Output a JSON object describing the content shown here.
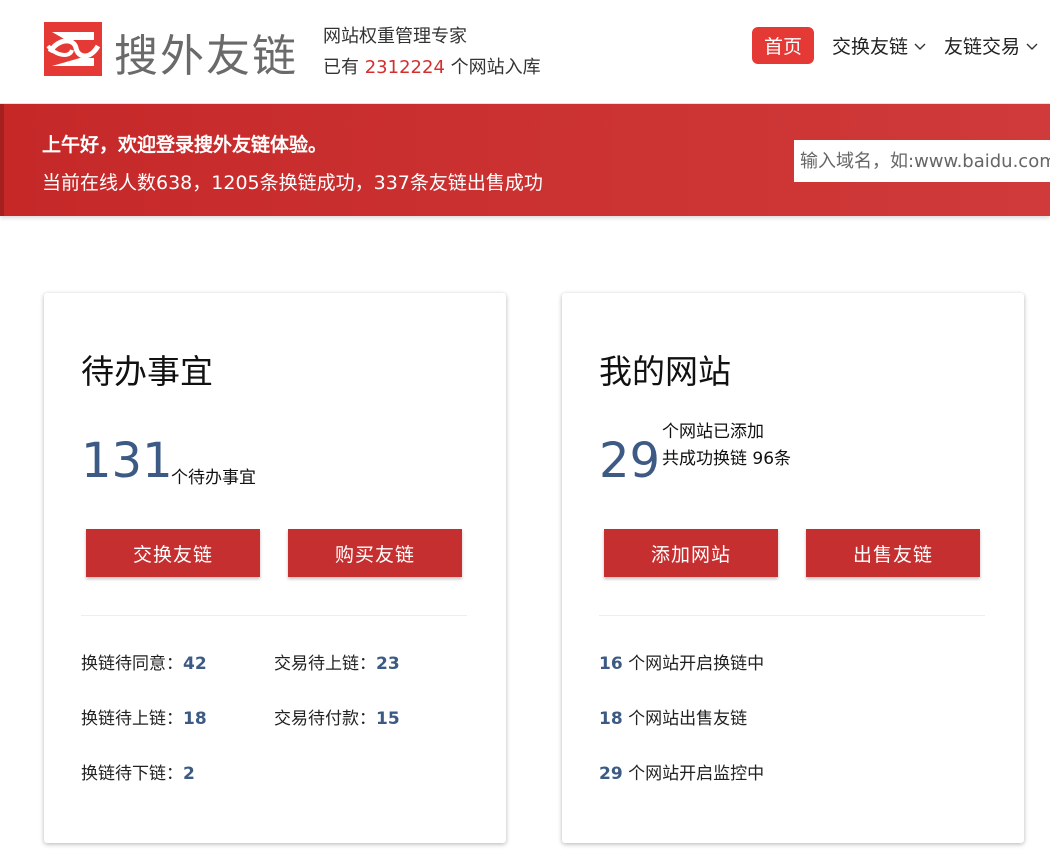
{
  "header": {
    "logo_text": "搜外友链",
    "slogan": "网站权重管理专家",
    "count_prefix": "已有",
    "count_value": "2312224",
    "count_suffix": "个网站入库",
    "nav": {
      "home": "首页",
      "exchange": "交换友链",
      "trade": "友链交易"
    },
    "brand_color": "#e53935"
  },
  "banner": {
    "welcome": "上午好，欢迎登录搜外友链体验。",
    "stats": "当前在线人数638，1205条换链成功，337条友链出售成功",
    "search_placeholder": "输入域名，如:www.baidu.com"
  },
  "todo": {
    "title": "待办事宜",
    "count": "131",
    "count_label": "个待办事宜",
    "btn_exchange": "交换友链",
    "btn_buy": "购买友链",
    "stats": [
      {
        "label": "换链待同意：",
        "value": "42"
      },
      {
        "label": "交易待上链：",
        "value": "23"
      },
      {
        "label": "换链待上链：",
        "value": "18"
      },
      {
        "label": "交易待付款：",
        "value": "15"
      },
      {
        "label": "换链待下链：",
        "value": "2"
      }
    ]
  },
  "sites": {
    "title": "我的网站",
    "count": "29",
    "count_label_1": "个网站已添加",
    "count_label_2": "共成功换链 96条",
    "btn_add": "添加网站",
    "btn_sell": "出售友链",
    "stats": [
      {
        "value": "16",
        "label": " 个网站开启换链中"
      },
      {
        "value": "18",
        "label": " 个网站出售友链"
      },
      {
        "value": "29",
        "label": " 个网站开启监控中"
      }
    ]
  }
}
